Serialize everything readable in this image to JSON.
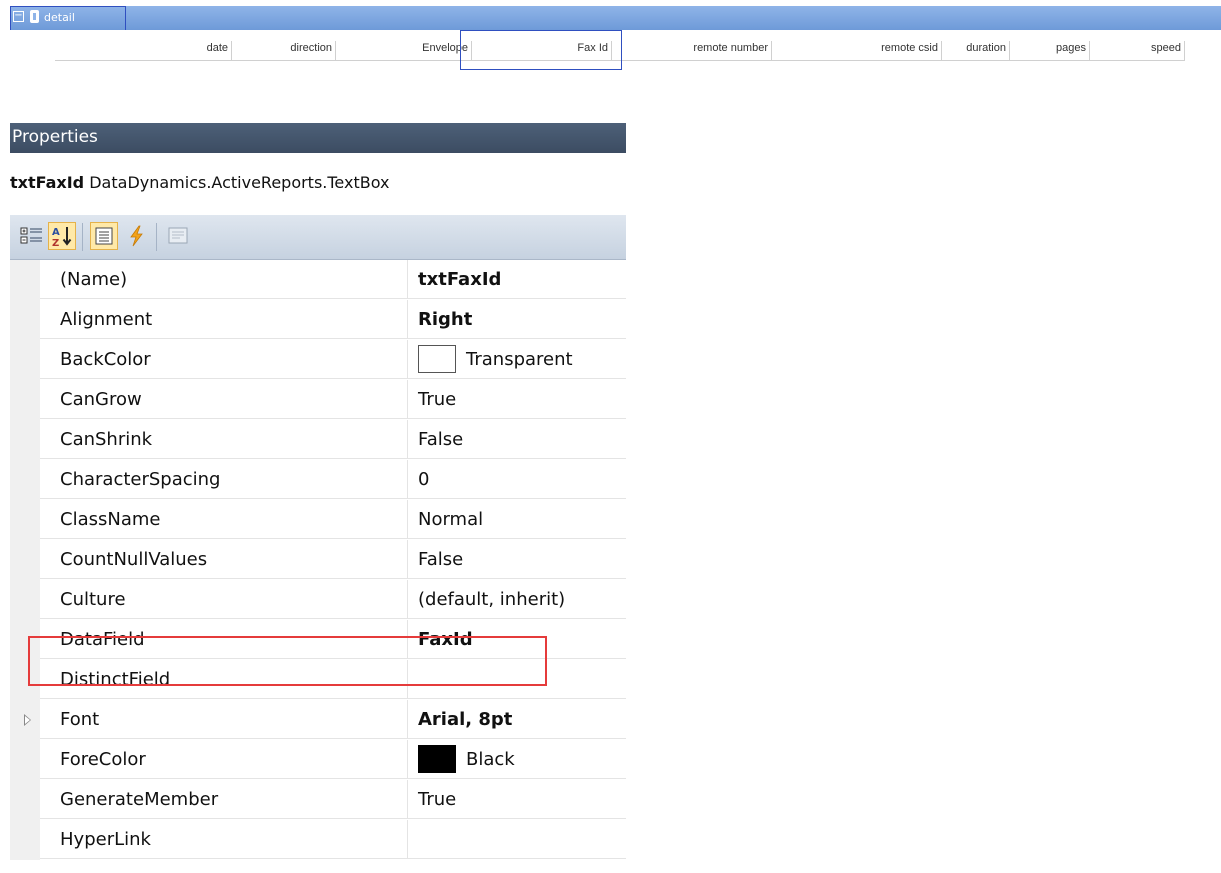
{
  "designer": {
    "section_label": "detail",
    "fields": [
      "date",
      "direction",
      "Envelope",
      "Fax Id",
      "remote number",
      "remote csid",
      "duration",
      "pages",
      "speed"
    ]
  },
  "properties": {
    "title": "Properties",
    "object_name": "txtFaxId",
    "object_type": "DataDynamics.ActiveReports.TextBox",
    "toolbar": [
      "categorized-icon",
      "alphabetical-icon",
      "properties-icon",
      "events-icon",
      "property-pages-icon"
    ],
    "rows": [
      {
        "name": "(Name)",
        "value": "txtFaxId",
        "bold": true
      },
      {
        "name": "Alignment",
        "value": "Right",
        "bold": true
      },
      {
        "name": "BackColor",
        "value": "Transparent",
        "swatch": "#FFFFFF"
      },
      {
        "name": "CanGrow",
        "value": "True"
      },
      {
        "name": "CanShrink",
        "value": "False"
      },
      {
        "name": "CharacterSpacing",
        "value": "0"
      },
      {
        "name": "ClassName",
        "value": "Normal"
      },
      {
        "name": "CountNullValues",
        "value": "False"
      },
      {
        "name": "Culture",
        "value": "(default, inherit)"
      },
      {
        "name": "DataField",
        "value": "FaxId",
        "bold": true
      },
      {
        "name": "DistinctField",
        "value": ""
      },
      {
        "name": "Font",
        "value": "Arial, 8pt",
        "bold": true,
        "expandable": true
      },
      {
        "name": "ForeColor",
        "value": "Black",
        "swatch": "#000000"
      },
      {
        "name": "GenerateMember",
        "value": "True"
      },
      {
        "name": "HyperLink",
        "value": ""
      }
    ]
  },
  "colors": {
    "title_bar": "#43546B",
    "section_bar": "#7EA6DF",
    "highlight": "#E53B3B",
    "selection": "#2F4FC0"
  }
}
